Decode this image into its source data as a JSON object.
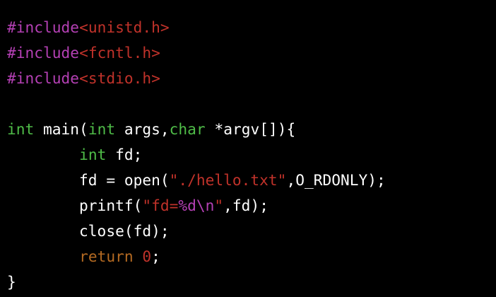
{
  "colors": {
    "background": "#000000",
    "plain": "#ffffff",
    "preprocessor": "#b440b4",
    "string": "#c0322a",
    "type": "#4fbc48",
    "keyword": "#b46a22",
    "escape": "#b440b4"
  },
  "code": {
    "lines": [
      [
        {
          "text": "#include",
          "kind": "preproc"
        },
        {
          "text": "<unistd.h>",
          "kind": "string"
        }
      ],
      [
        {
          "text": "#include",
          "kind": "preproc"
        },
        {
          "text": "<fcntl.h>",
          "kind": "string"
        }
      ],
      [
        {
          "text": "#include",
          "kind": "preproc"
        },
        {
          "text": "<stdio.h>",
          "kind": "string"
        }
      ],
      [],
      [
        {
          "text": "int",
          "kind": "type"
        },
        {
          "text": " main(",
          "kind": "plain"
        },
        {
          "text": "int",
          "kind": "type"
        },
        {
          "text": " args,",
          "kind": "plain"
        },
        {
          "text": "char",
          "kind": "type"
        },
        {
          "text": " *argv[]){",
          "kind": "plain"
        }
      ],
      [
        {
          "text": "        ",
          "kind": "plain"
        },
        {
          "text": "int",
          "kind": "type"
        },
        {
          "text": " fd;",
          "kind": "plain"
        }
      ],
      [
        {
          "text": "        fd = open(",
          "kind": "plain"
        },
        {
          "text": "\"./hello.txt\"",
          "kind": "string"
        },
        {
          "text": ",O_RDONLY);",
          "kind": "plain"
        }
      ],
      [
        {
          "text": "        printf(",
          "kind": "plain"
        },
        {
          "text": "\"fd=",
          "kind": "string"
        },
        {
          "text": "%d\\n",
          "kind": "escape"
        },
        {
          "text": "\"",
          "kind": "string"
        },
        {
          "text": ",fd);",
          "kind": "plain"
        }
      ],
      [
        {
          "text": "        close(fd);",
          "kind": "plain"
        }
      ],
      [
        {
          "text": "        ",
          "kind": "plain"
        },
        {
          "text": "return",
          "kind": "keyword"
        },
        {
          "text": " ",
          "kind": "plain"
        },
        {
          "text": "0",
          "kind": "string"
        },
        {
          "text": ";",
          "kind": "plain"
        }
      ],
      [
        {
          "text": "}",
          "kind": "plain"
        }
      ]
    ]
  }
}
